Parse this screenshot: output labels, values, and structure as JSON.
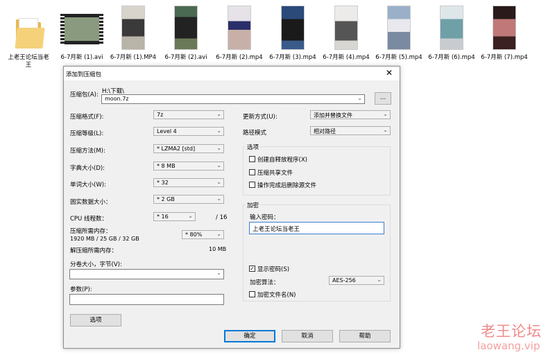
{
  "files": [
    {
      "name": "上老王论坛当老",
      "name2": "王",
      "icon": "folder-icon"
    },
    {
      "name": "6-7月新 (1).avi",
      "icon": "video-thumbnail"
    },
    {
      "name": "6-7月新 (1).MP4",
      "icon": "video-thumbnail"
    },
    {
      "name": "6-7月新 (2).avi",
      "icon": "video-thumbnail"
    },
    {
      "name": "6-7月新 (2).mp4",
      "icon": "video-thumbnail"
    },
    {
      "name": "6-7月新 (3).mp4",
      "icon": "video-thumbnail"
    },
    {
      "name": "6-7月新 (4).mp4",
      "icon": "video-thumbnail"
    },
    {
      "name": "6-7月新 (5).mp4",
      "icon": "video-thumbnail"
    },
    {
      "name": "6-7月新 (6).mp4",
      "icon": "video-thumbnail"
    },
    {
      "name": "6-7月新 (7).mp4",
      "icon": "video-thumbnail"
    }
  ],
  "dialog": {
    "title": "添加到压缩包",
    "close": "✕",
    "archive_label": "压缩包(A):",
    "archive_path": "H:\\下载\\",
    "archive_name": "moon.7z",
    "browse": "...",
    "format_label": "压缩格式(F):",
    "format": "7z",
    "level_label": "压缩等级(L):",
    "level": "Level 4",
    "method_label": "压缩方法(M):",
    "method": "* LZMA2 [std]",
    "dict_label": "字典大小(D):",
    "dict": "* 8 MB",
    "word_label": "单词大小(W):",
    "word": "* 32",
    "solid_label": "固实数据大小：",
    "solid": "* 2 GB",
    "cpu_label": "CPU 线程数：",
    "cpu": "* 16",
    "cpu_total": "/ 16",
    "mem_label": "压缩所需内存：",
    "mem_value": "1920 MB / 25 GB / 32 GB",
    "mem_pct": "* 80%",
    "decomp_label": "解压缩所需内存：",
    "decomp_value": "10 MB",
    "split_label": "分卷大小，字节(V):",
    "split_value": "",
    "params_label": "参数(P):",
    "params_value": "",
    "options_btn": "选项",
    "update_label": "更新方式(U):",
    "update": "添加并替换文件",
    "path_label": "路径模式",
    "path_mode": "相对路径",
    "opts_group": "选项",
    "opt_sfx": "创建自释放程序(X)",
    "opt_shared": "压缩共享文件",
    "opt_delete": "操作完成后删除源文件",
    "enc_group": "加密",
    "pw_label": "输入密码：",
    "pw_value": "上老王论坛当老王",
    "show_pw": "显示密码(S)",
    "enc_method_label": "加密算法：",
    "enc_method": "AES-256",
    "enc_names": "加密文件名(N)",
    "ok": "确定",
    "cancel": "取消",
    "help": "帮助"
  },
  "watermark": {
    "line1": "老王论坛",
    "line2": "laowang.vip"
  }
}
